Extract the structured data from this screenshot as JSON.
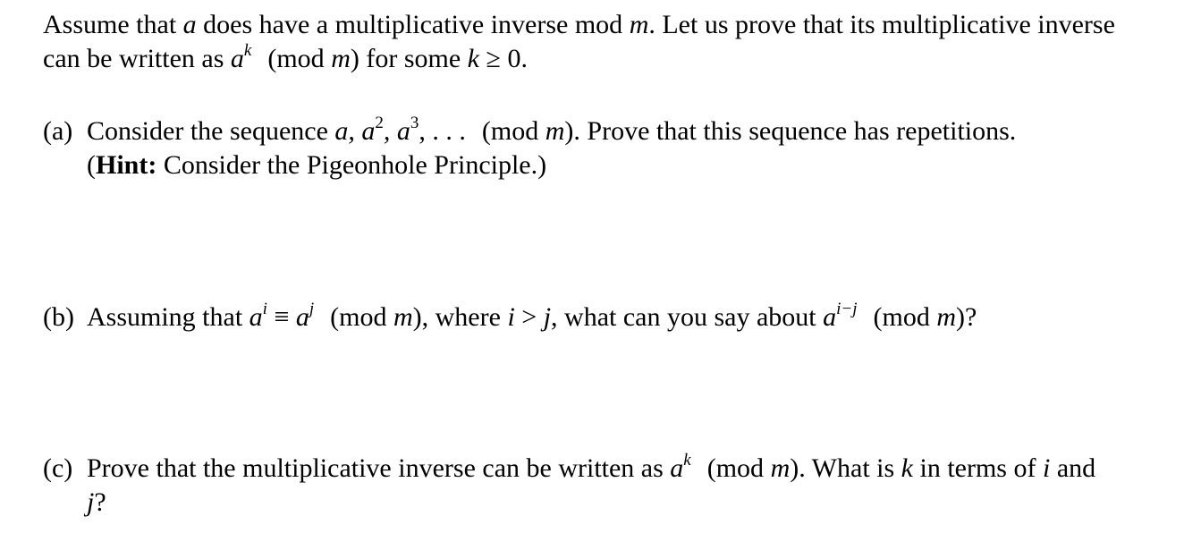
{
  "intro": {
    "line1": "Assume that a does have a multiplicative inverse mod m. Let us prove that its multiplicative inverse",
    "line2": "can be written as a^k (mod m) for some k ≥ 0.",
    "l1_p1": "Assume that ",
    "l1_a": "a",
    "l1_p2": " does have a multiplicative inverse mod ",
    "l1_m": "m",
    "l1_p3": ". Let us prove that its multiplicative inverse",
    "l2_p1": "can be written as ",
    "l2_a": "a",
    "l2_k": "k",
    "l2_mod": "(mod ",
    "l2_m": "m",
    "l2_p2": ") for some ",
    "l2_k2": "k",
    "l2_p3": " ≥ 0."
  },
  "parts": {
    "a": {
      "label": "(a)",
      "p1": "Consider the sequence ",
      "seq": "a, a",
      "e2": "2",
      "seq2": ", a",
      "e3": "3",
      "seq3": ", . . .",
      "mod": "(mod ",
      "m": "m",
      "p2": "). Prove that this sequence has repetitions.",
      "hint_open": "(",
      "hint_bold": "Hint:",
      "hint_rest": " Consider the Pigeonhole Principle.)"
    },
    "b": {
      "label": "(b)",
      "p1": "Assuming that ",
      "a1": "a",
      "ei": "i",
      "equiv": " ≡ ",
      "a2": "a",
      "ej": "j",
      "mod": "(mod ",
      "m": "m",
      "p2": "), where ",
      "i": "i",
      "gt": " > ",
      "j": "j",
      "p3": ", what can you say about ",
      "a3": "a",
      "eij": "i−j",
      "mod2": "(mod ",
      "m2": "m",
      "p4": ")?"
    },
    "c": {
      "label": "(c)",
      "p1": "Prove that the multiplicative inverse can be written as ",
      "a": "a",
      "k": "k",
      "mod": "(mod ",
      "m": "m",
      "p2": "). What is ",
      "k2": "k",
      "p3": " in terms of ",
      "i": "i",
      "p4": " and",
      "j": "j",
      "p5": "?"
    }
  }
}
